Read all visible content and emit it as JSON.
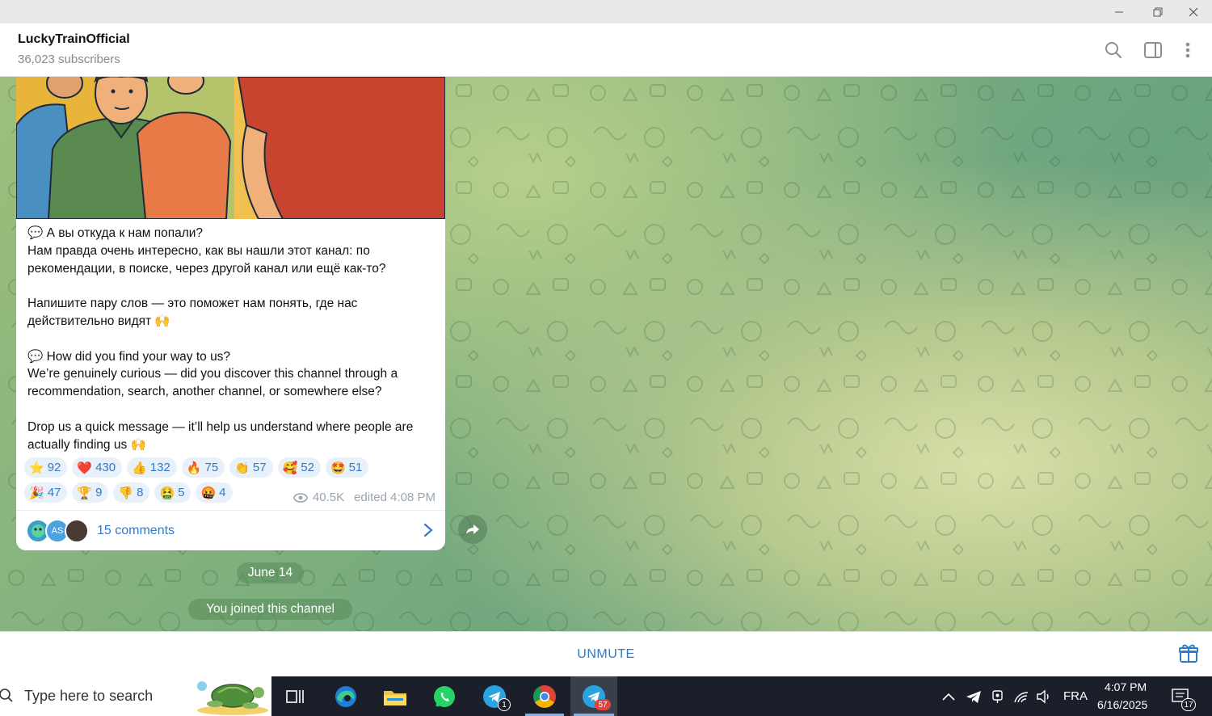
{
  "window": {
    "minimize_icon": "minimize-icon",
    "restore_icon": "restore-icon",
    "close_icon": "close-icon"
  },
  "header": {
    "title": "LuckyTrainOfficial",
    "subtitle": "36,023 subscribers",
    "icons": [
      "search-icon",
      "sidebar-toggle-icon",
      "more-vertical-icon"
    ]
  },
  "post": {
    "text_ru_q": "💬 А вы откуда к нам попали?",
    "text_ru_1": "Нам правда очень интересно, как вы нашли этот канал: по рекомендации, в поиске, через другой канал или ещё как-то?",
    "text_ru_2": "Напишите пару слов — это поможет нам понять, где нас действительно видят 🙌",
    "text_en_q": "💬 How did you find your way to us?",
    "text_en_1": "We’re genuinely curious — did you discover this channel through a recommendation, search, another channel, or somewhere else?",
    "text_en_2": "Drop us a quick message — it’ll help us understand where people are actually finding us 🙌",
    "reactions_row1": [
      {
        "emoji": "⭐",
        "count": "92"
      },
      {
        "emoji": "❤️",
        "count": "430"
      },
      {
        "emoji": "👍",
        "count": "132"
      },
      {
        "emoji": "🔥",
        "count": "75"
      },
      {
        "emoji": "👏",
        "count": "57"
      },
      {
        "emoji": "🥰",
        "count": "52"
      },
      {
        "emoji": "🤩",
        "count": "51"
      }
    ],
    "reactions_row2": [
      {
        "emoji": "🎉",
        "count": "47"
      },
      {
        "emoji": "🏆",
        "count": "9"
      },
      {
        "emoji": "👎",
        "count": "8"
      },
      {
        "emoji": "🤮",
        "count": "5"
      },
      {
        "emoji": "🤬",
        "count": "4"
      }
    ],
    "views": "40.5K",
    "edited": "edited 4:08 PM",
    "comments_label": "15 comments",
    "avatar_initials": "AS"
  },
  "service": {
    "date": "June 14",
    "joined": "You joined this channel"
  },
  "bottom": {
    "unmute_label": "UNMUTE"
  },
  "taskbar": {
    "search_placeholder": "Type here to search",
    "telegram_badge": "1",
    "telegram_active_badge": "57",
    "language": "FRA",
    "time": "4:07 PM",
    "date": "6/16/2025",
    "notification_count": "17"
  },
  "colors": {
    "accent": "#2f7ac9",
    "reaction_bg": "#e8f1fa",
    "taskbar_bg": "#1b1f2a"
  }
}
